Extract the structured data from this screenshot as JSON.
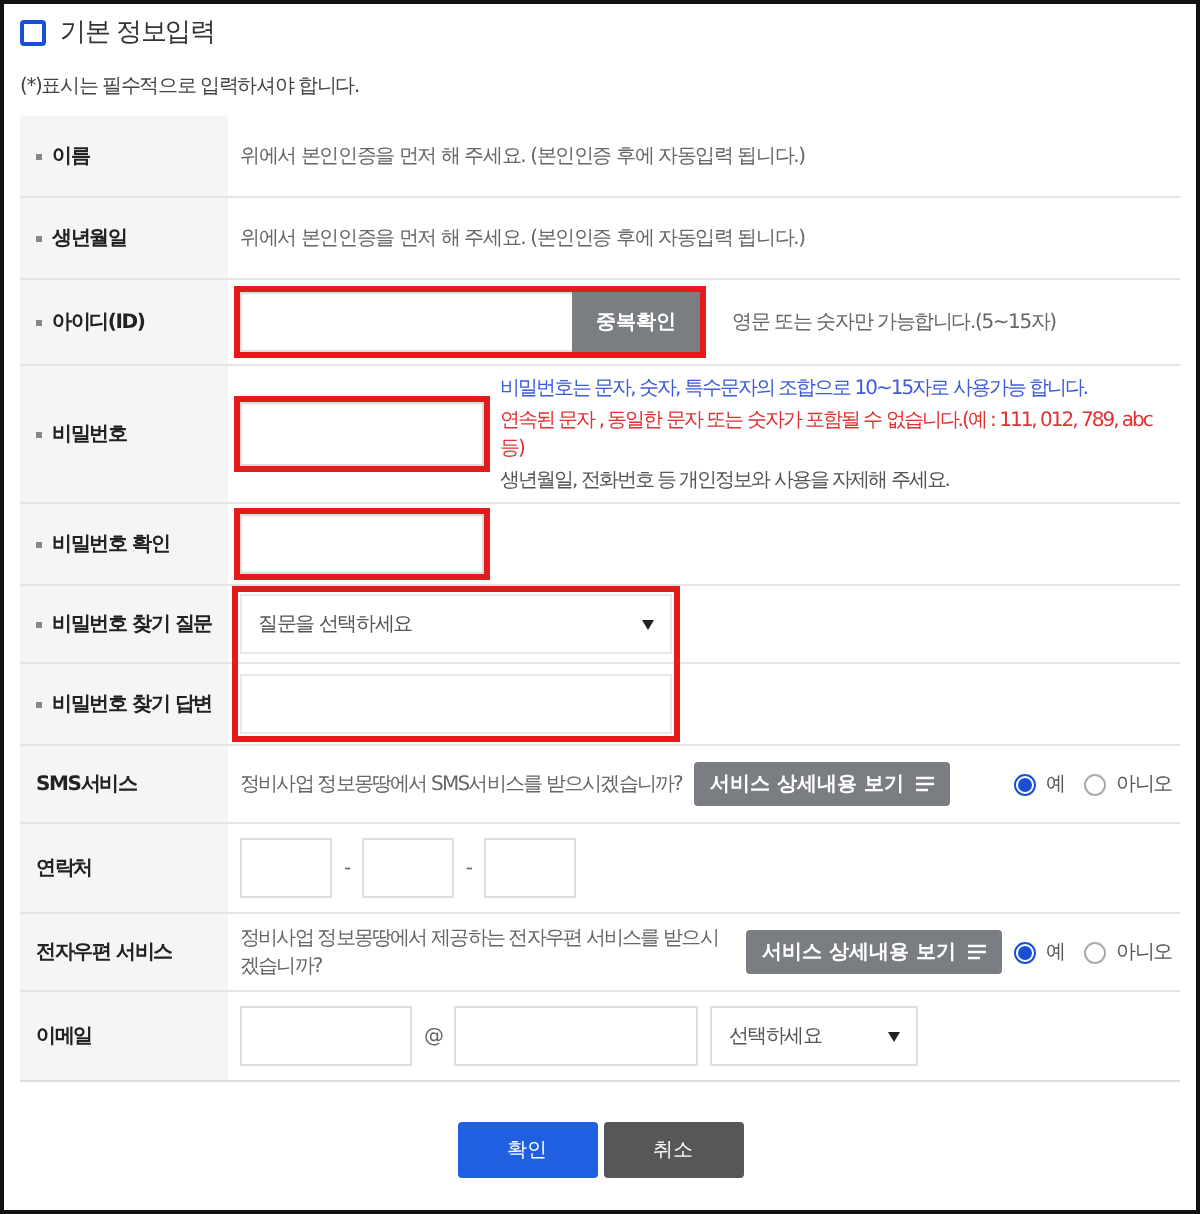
{
  "section": {
    "title": "기본 정보입력",
    "note": "(*)표시는 필수적으로 입력하셔야 합니다."
  },
  "rows": [
    {
      "label": "이름",
      "required": true,
      "kind": "note",
      "text": "위에서 본인인증을 먼저 해 주세요. (본인인증 후에 자동입력 됩니다.)"
    },
    {
      "label": "생년월일",
      "required": true,
      "kind": "note",
      "text": "위에서 본인인증을 먼저 해 주세요. (본인인증 후에 자동입력 됩니다.)"
    },
    {
      "label": "아이디(ID)",
      "required": true,
      "kind": "id",
      "button": "중복확인",
      "hint": "영문 또는 숫자만 가능합니다.(5~15자)",
      "highlighted": true
    },
    {
      "label": "비밀번호",
      "required": true,
      "kind": "password",
      "highlighted": true,
      "hints": [
        {
          "text": "비밀번호는 문자, 숫자, 특수문자의 조합으로 10~15자로 사용가능 합니다.",
          "color": "#3b5bdb"
        },
        {
          "text": "연속된 문자 , 동일한 문자 또는 숫자가 포함될 수 없습니다.(예 : 111, 012, 789, abc 등)",
          "color": "#e03131"
        },
        {
          "text": "생년월일, 전화번호 등 개인정보와 사용을 자제해 주세요.",
          "color": "#555555"
        }
      ]
    },
    {
      "label": "비밀번호 확인",
      "required": true,
      "kind": "text",
      "highlighted": true
    },
    {
      "label": "비밀번호 찾기 질문",
      "required": true,
      "kind": "select",
      "value": "질문을 선택하세요",
      "group_highlight": true
    },
    {
      "label": "비밀번호 찾기 답변",
      "required": true,
      "kind": "text",
      "group_highlight": true
    },
    {
      "label": "SMS서비스",
      "required": false,
      "kind": "service",
      "text": "정비사업 정보몽땅에서 SMS서비스를 받으시겠습니까?",
      "button": "서비스 상세내용 보기",
      "options": [
        {
          "label": "예",
          "selected": true
        },
        {
          "label": "아니오",
          "selected": false
        }
      ]
    },
    {
      "label": "연락처",
      "required": false,
      "kind": "phone",
      "separators": [
        "-",
        "-"
      ]
    },
    {
      "label": "전자우편 서비스",
      "required": false,
      "kind": "service",
      "text": "정비사업 정보몽땅에서 제공하는 전자우편 서비스를 받으시겠습니까?",
      "button": "서비스 상세내용 보기",
      "options": [
        {
          "label": "예",
          "selected": true
        },
        {
          "label": "아니오",
          "selected": false
        }
      ]
    },
    {
      "label": "이메일",
      "required": false,
      "kind": "email",
      "at": "@",
      "select": "선택하세요"
    }
  ],
  "buttons": [
    {
      "label": "확인",
      "kind": "primary"
    },
    {
      "label": "취소",
      "kind": "secondary"
    }
  ]
}
